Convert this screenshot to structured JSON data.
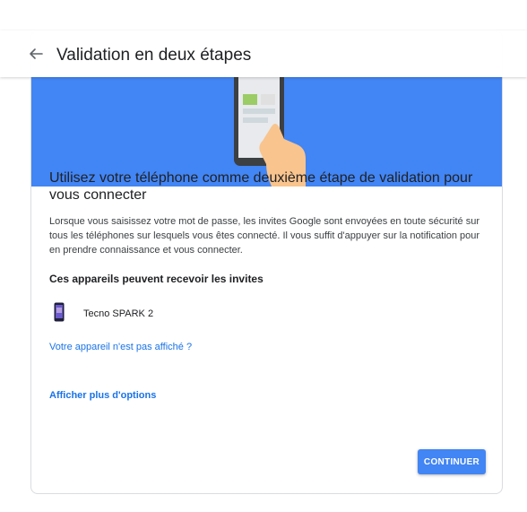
{
  "appbar": {
    "back_icon": "arrow-back-icon",
    "title": "Validation en deux étapes"
  },
  "hero": {
    "illustration": "phone-tap-illustration",
    "background_color": "#4285f4"
  },
  "content": {
    "heading": "Utilisez votre téléphone comme deuxième étape de validation pour vous connecter",
    "description": "Lorsque vous saisissez votre mot de passe, les invites Google sont envoyées en toute sécurité sur tous les téléphones sur lesquels vous êtes connecté. Il vous suffit d'appuyer sur la notification pour en prendre connaissance et vous connecter.",
    "devices_heading": "Ces appareils peuvent recevoir les invites",
    "devices": [
      {
        "name": "Tecno SPARK 2",
        "icon": "smartphone-icon"
      }
    ],
    "missing_device_link": "Votre appareil n'est pas affiché ?",
    "more_options_link": "Afficher plus d'options"
  },
  "actions": {
    "continue_label": "CONTINUER",
    "accent_color": "#4285f4",
    "link_color": "#1a73e8"
  }
}
